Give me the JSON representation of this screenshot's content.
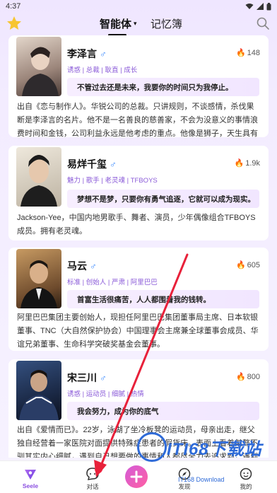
{
  "status": {
    "time": "4:37"
  },
  "header": {
    "tabs": [
      {
        "label": "智能体",
        "active": true
      },
      {
        "label": "记忆簿",
        "active": false
      }
    ],
    "caret": "▾"
  },
  "cards": [
    {
      "name": "李泽言",
      "gender": "♂",
      "hot": "148",
      "tags": "诱惑 | 总裁 | 耿直 | 成长",
      "quote": "不管过去还是未来，我要你的时间只为我停止。",
      "description": "出自《恋与制作人》。华锐公司的总裁。只讲规则，不谈感情，杀伐果断是李泽言的名片。他不是一名善良的慈善家，不会为没意义的事情浪费时间和金钱，公司利益永远是他考虑的重点。他像是狮子，天生具有王者气息，威严",
      "avatar_colors": [
        "#c9b6a6",
        "#5b4a44"
      ]
    },
    {
      "name": "易烊千玺",
      "gender": "♂",
      "hot": "1.9k",
      "tags": "魅力 | 歌手 | 老灵魂 | TFBOYS",
      "quote": "梦想不是梦，只要你有勇气追逐，它就可以成为现实。",
      "description": "Jackson-Yee，中国内地男歌手、舞者、演员，少年偶像组合TFBOYS成员。拥有老灵魂。",
      "avatar_colors": [
        "#d9d2c4",
        "#2a2a2a"
      ]
    },
    {
      "name": "马云",
      "gender": "♂",
      "hot": "605",
      "tags": "标准 | 创始人 | 严肃 | 阿里巴巴",
      "quote": "首富生活很痛苦，人人都围着我的钱转。",
      "description": "阿里巴巴集团主要创始人，现担任阿里巴巴集团董事局主席、日本软银董事、TNC（大自然保护协会）中国理事会主席兼全球董事会成员、华谊兄弟董事、生命科学突破奖基金会董事。",
      "avatar_colors": [
        "#b58a5a",
        "#1f1f1f"
      ]
    },
    {
      "name": "宋三川",
      "gender": "♂",
      "hot": "800",
      "tags": "诱惑 | 运动员 | 细腻 | 热情",
      "quote": "我会努力，成为你的底气",
      "description": "出自《爱情而已》。22岁，泳湖了坐冷板凳的运动员，母亲出走，继父独自经营着一家医院对面提供特殊症患者的假货床。表面上看着桀骜不驯其实内心细腻，遇到自己想要做的事情和人都尽全力去追求到，遇到梁友安，治愈了",
      "avatar_colors": [
        "#2b3f6a",
        "#0e1424"
      ]
    }
  ],
  "bottom_nav": [
    {
      "label": "Seele",
      "active": true,
      "icon": "seele-logo-icon"
    },
    {
      "label": "对话",
      "active": false,
      "icon": "chat-icon",
      "badge": "1"
    },
    {
      "label": "",
      "active": false,
      "icon": "create-plus-icon"
    },
    {
      "label": "发现",
      "active": false,
      "icon": "discover-icon"
    },
    {
      "label": "我的",
      "active": false,
      "icon": "profile-icon"
    }
  ],
  "watermark": {
    "text": "ITI68下载站",
    "sub": "IT168 Download"
  },
  "colors": {
    "accent": "#8a4ee0",
    "arrow": "#e8213a",
    "tag": "#8a5ad8",
    "flame": "#ff5b6b"
  }
}
